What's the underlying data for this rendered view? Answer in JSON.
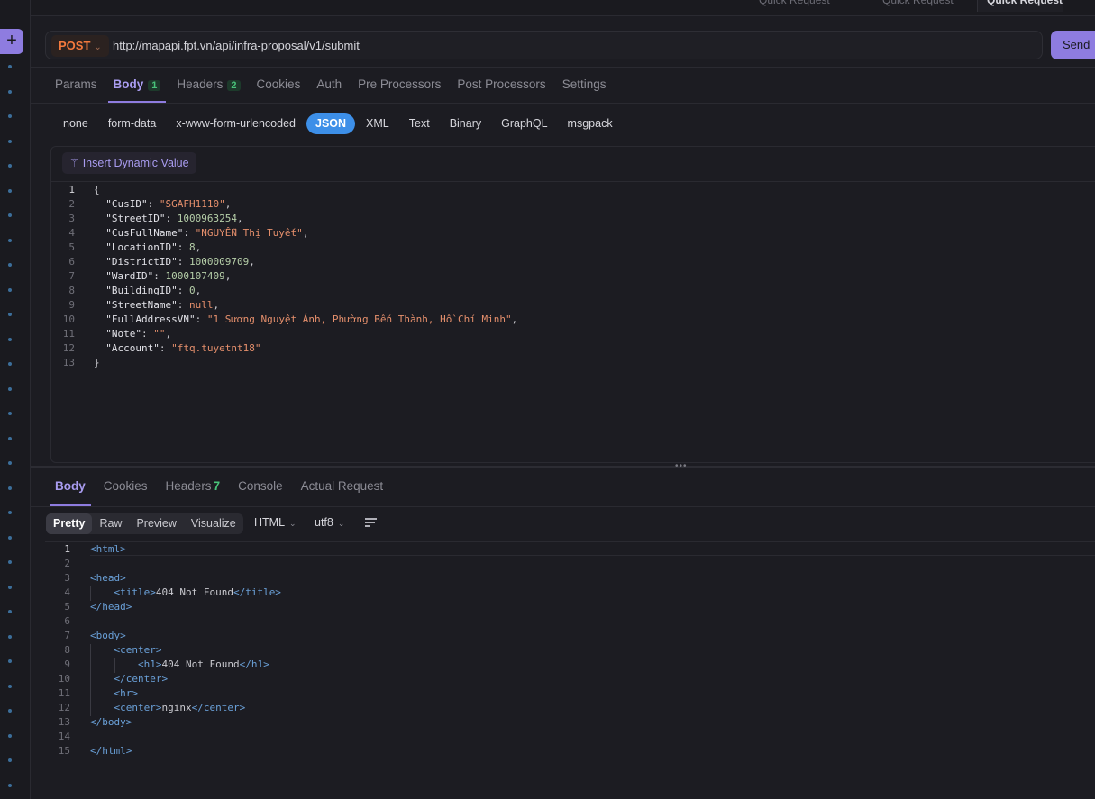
{
  "tabs": [
    "Quick Request",
    "Quick Request",
    "Quick Request"
  ],
  "url_bar": {
    "method": "POST",
    "url": "http://mapapi.fpt.vn/api/infra-proposal/v1/submit",
    "send_label": "Send"
  },
  "request_tabs": [
    {
      "label": "Params"
    },
    {
      "label": "Body",
      "badge": "1"
    },
    {
      "label": "Headers",
      "badge": "2"
    },
    {
      "label": "Cookies"
    },
    {
      "label": "Auth"
    },
    {
      "label": "Pre Processors"
    },
    {
      "label": "Post Processors"
    },
    {
      "label": "Settings"
    }
  ],
  "body_types": [
    "none",
    "form-data",
    "x-www-form-urlencoded",
    "JSON",
    "XML",
    "Text",
    "Binary",
    "GraphQL",
    "msgpack"
  ],
  "active_body_type": "JSON",
  "insert_dynamic_value": "Insert Dynamic Value",
  "request_body_lines": [
    "{",
    "  \"CusID\": \"SGAFH1110\",",
    "  \"StreetID\": 1000963254,",
    "  \"CusFullName\": \"NGUYỄN Thị Tuyết\",",
    "  \"LocationID\": 8,",
    "  \"DistrictID\": 1000009709,",
    "  \"WardID\": 1000107409,",
    "  \"BuildingID\": 0,",
    "  \"StreetName\": null,",
    "  \"FullAddressVN\": \"1 Sương Nguyệt Ánh, Phường Bến Thành, Hồ Chí Minh\",",
    "  \"Note\": \"\",",
    "  \"Account\": \"ftq.tuyetnt18\"",
    "}"
  ],
  "response_tabs": [
    {
      "label": "Body"
    },
    {
      "label": "Cookies"
    },
    {
      "label": "Headers",
      "badge": "7"
    },
    {
      "label": "Console"
    },
    {
      "label": "Actual Request"
    }
  ],
  "view_modes": [
    "Pretty",
    "Raw",
    "Preview",
    "Visualize"
  ],
  "active_view_mode": "Pretty",
  "format_select": "HTML",
  "encoding_select": "utf8",
  "response_lines": [
    "<html>",
    "",
    "<head>",
    "    <title>404 Not Found</title>",
    "</head>",
    "",
    "<body>",
    "    <center>",
    "        <h1>404 Not Found</h1>",
    "    </center>",
    "    <hr>",
    "    <center>nginx</center>",
    "</body>",
    "",
    "</html>"
  ],
  "colors": {
    "accent": "#8e7ce0",
    "method": "#f57a3d",
    "json_active": "#3d8fe8",
    "badge_green": "#49c47a",
    "string": "#e58f6c",
    "number": "#b5cea8",
    "tag": "#6aa0d8"
  }
}
